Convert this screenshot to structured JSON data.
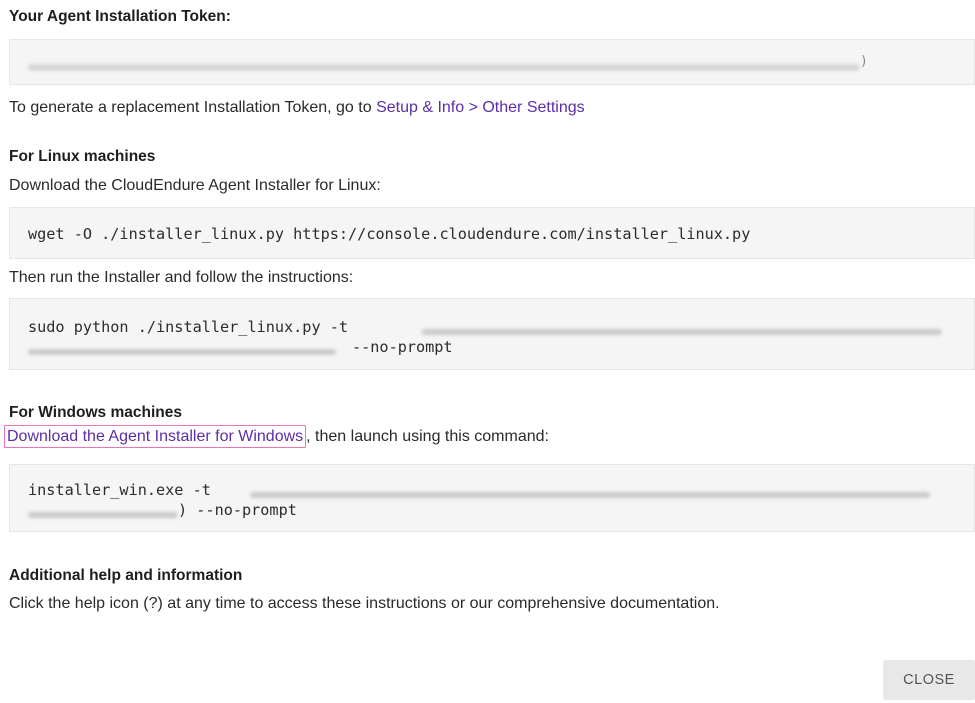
{
  "token_section": {
    "title": "Your Agent Installation Token:",
    "replace_prefix": "To generate a replacement Installation Token, go to ",
    "replace_link": "Setup & Info > Other Settings"
  },
  "linux": {
    "title": "For Linux machines",
    "download_text": "Download the CloudEndure Agent Installer for Linux:",
    "download_cmd": "wget -O ./installer_linux.py https://console.cloudendure.com/installer_linux.py",
    "run_text": "Then run the Installer and follow the instructions:",
    "run_cmd_prefix": "sudo python ./installer_linux.py -t",
    "run_cmd_suffix": "--no-prompt"
  },
  "windows": {
    "title": "For Windows machines",
    "download_link": "Download the Agent Installer for Windows",
    "download_suffix": ", then launch using this command:",
    "cmd_prefix": "installer_win.exe -t",
    "cmd_suffix": ") --no-prompt"
  },
  "help": {
    "title": "Additional help and information",
    "text": "Click the help icon (?) at any time to access these instructions or our comprehensive documentation."
  },
  "footer": {
    "close_label": "CLOSE"
  },
  "colors": {
    "link": "#5b2ea6",
    "highlight": "#e874b8",
    "box_bg": "#f5f5f5"
  }
}
